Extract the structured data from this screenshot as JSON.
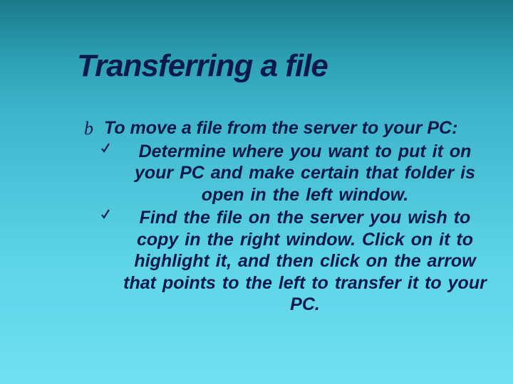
{
  "title": "Transferring a file",
  "body": {
    "levelOne": "To move a file from the server to your PC:",
    "levelTwo": [
      "Determine where you want to put it on your PC and make certain that folder is open in the left window.",
      "Find the  file on the server you wish to copy in the right window.  Click on it to highlight it, and then click on the arrow that points to the left to transfer it to your PC."
    ]
  }
}
